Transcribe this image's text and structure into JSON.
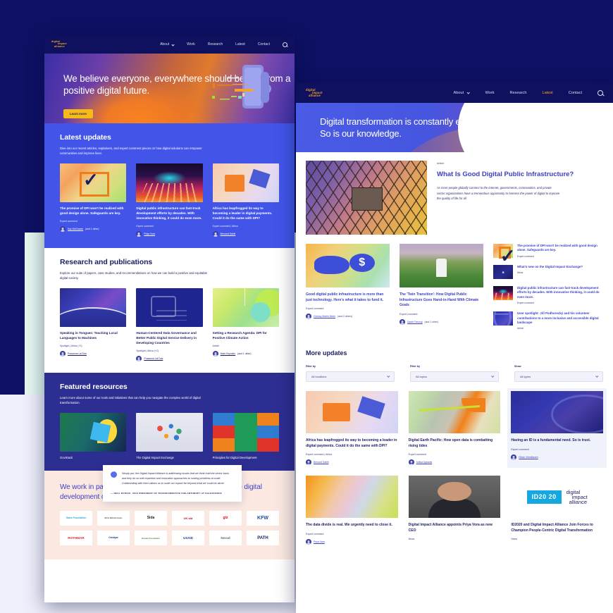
{
  "nav": {
    "logo_lines": [
      "digital",
      "impact",
      "alliance"
    ],
    "links": [
      "About",
      "Work",
      "Research",
      "Latest",
      "Contact"
    ],
    "active_link": "Latest",
    "search_icon": "search-icon",
    "chevron_icon": "chevron-down-icon"
  },
  "home": {
    "hero": {
      "headline": "We believe everyone, everywhere should benefit from a positive digital future.",
      "cta": "Learn more"
    },
    "latest": {
      "title": "Latest updates",
      "lede": "Dive into our recent articles, explainers, and expert comment pieces on how digital solutions can empower communities and improve lives.",
      "cards": [
        {
          "art": "art-check",
          "title": "The promise of DPI won't be realized with good design alone. Safeguards are key.",
          "meta": "Expert comment",
          "author": "Kay McGowan",
          "author_extra": "(and 1 other)"
        },
        {
          "art": "art-road",
          "title": "Digital public infrastructure can fast-track development efforts by decades. With innovative thinking, it could do even more.",
          "meta": "Expert comment",
          "author": "Priya Vora",
          "author_extra": ""
        },
        {
          "art": "art-africa",
          "title": "Africa has leapfrogged its way to becoming a leader in digital payments. Could it do the same with DPI?",
          "meta": "Expert comment | Africa",
          "author": "Bernard Sabiti",
          "author_extra": ""
        }
      ]
    },
    "research": {
      "title": "Research and publications",
      "lede": "Explore our suite of papers, case studies, and recommendations on how we can build a positive and equitable digital society.",
      "cards": [
        {
          "art": "art-wave",
          "title": "Speaking in Tongues: Teaching Local Languages to Machines",
          "meta": "Spotlight | Africa (+2)",
          "author": "Prasanna Lal Das",
          "author_extra": ""
        },
        {
          "art": "art-code",
          "title": "Human-Centered Data Governance and Better Public Digital Service Delivery in Developing Countries",
          "meta": "Spotlight | Africa (+2)",
          "author": "Prasanna Lal Das",
          "author_extra": ""
        },
        {
          "art": "art-green",
          "title": "Setting a Research Agenda: DPI for Positive Climate Action",
          "meta": "Article",
          "author": "Mark Esposito",
          "author_extra": "(and 1 other)"
        }
      ]
    },
    "featured": {
      "title": "Featured resources",
      "lede": "Learn more about some of our tools and initiatives that can help you navigate the complex world of digital transformation.",
      "cards": [
        {
          "art": "art-govstack",
          "title": "GovStack"
        },
        {
          "art": "art-iso",
          "title": "The Digital Impact Exchange"
        },
        {
          "art": "art-grid9",
          "title": "Principles for Digital Development"
        }
      ]
    },
    "quote": {
      "icon": "quote-icon",
      "text": "Simply put, the Digital Impact Alliance is addressing issues that we think hold the sector back, and they do so with expertise and innovative approaches to solving problems at scale. Collaborating with them allows us to scale our impact far beyond what we could do alone.",
      "attribution": "— NEAL MYRICK, VICE PRESIDENT OF TRANSFORMATIVE PHILANTHROPY AT SALESFORCE"
    },
    "partners": {
      "title": "We work in partnership with some of the world's most active digital development champions.",
      "logos": [
        "Gates Foundation",
        "Bill & Melinda Gates",
        "Sida",
        "UK aid",
        "giz",
        "KFW",
        "ROTHMAR",
        "Omidyar",
        "Hewlett Foundation",
        "USAID",
        "Norad",
        "PATH"
      ]
    }
  },
  "latest_page": {
    "hero": {
      "line1": "Digital transformation is constantly evolving.",
      "line2": "So is our knowledge."
    },
    "feature": {
      "art": "art-tower",
      "kicker": "Article",
      "title": "What Is Good Digital Public Infrastructure?",
      "excerpt": "As more people globally connect to the internet, governments, communities, and private sector organizations have a tremendous opportunity to harness the power of digital to improve the quality of life for all"
    },
    "mid_cards": [
      {
        "art": "art-hand",
        "title": "Good digital public infrastructure is more than just technology. Here's what it takes to fund it.",
        "meta": "Expert comment",
        "author": "Chrissy Martin Meier",
        "author_extra": "(and 2 others)"
      },
      {
        "art": "art-farm",
        "title": "The 'Twin Transition': How Digital Public Infrastructure Goes Hand-in-Hand With Climate Goals",
        "meta": "Expert comment",
        "author": "Sarah Farooqi",
        "author_extra": "(and 1 other)"
      }
    ],
    "side_list": [
      {
        "art": "art-check",
        "title": "The promise of DPI won't be realized with good design alone. Safeguards are key.",
        "meta": "Expert comment"
      },
      {
        "art": "art-whatsnew",
        "title": "What's new on the Digital Impact Exchange?",
        "meta": "News"
      },
      {
        "art": "art-road",
        "title": "Digital public infrastructure can fast-track development efforts by decades. With innovative thinking, it could do even more.",
        "meta": "Expert comment"
      },
      {
        "art": "art-dpi2",
        "title": "User spotlight: Jiří Podhorecký and his volunteer contributions to a more inclusive and accessible digital landscape",
        "meta": "Article"
      }
    ],
    "more": {
      "title": "More updates",
      "filters": [
        {
          "label": "Filter by",
          "value": "All locations"
        },
        {
          "label": "Filter by",
          "value": "All topics"
        },
        {
          "label": "Show",
          "value": "All types"
        }
      ],
      "cards": [
        {
          "art": "art-africa",
          "title": "Africa has leapfrogged its way to becoming a leader in digital payments. Could it do the same with DPI?",
          "meta": "Expert comment | Africa",
          "author": "Bernard Sabiti",
          "author_extra": "",
          "highlight": false
        },
        {
          "art": "art-pacific",
          "title": "Digital Earth Pacific: How open data is combatting rising tides",
          "meta": "Expert comment",
          "author": "Aditya Agrawal",
          "author_extra": "",
          "highlight": false
        },
        {
          "art": "art-id",
          "title": "Having an ID is a fundamental need. So is trust.",
          "meta": "Expert comment",
          "author": "Ethan Veneklasen",
          "author_extra": "",
          "highlight": true
        },
        {
          "art": "art-warm",
          "title": "The data divide is real. We urgently need to close it.",
          "meta": "Expert comment",
          "author": "Priya Vora",
          "author_extra": "",
          "highlight": false
        },
        {
          "art": "art-ceo",
          "title": "Digital Impact Alliance appoints Priya Vora as new CEO",
          "meta": "News",
          "author": "",
          "author_extra": "",
          "highlight": false
        },
        {
          "art": "id2020",
          "title": "ID2020 and Digital Impact Alliance Join Forces to Champion People-Centric Digital Transformation",
          "meta": "News",
          "author": "",
          "author_extra": "",
          "highlight": false,
          "id2020_label": "ID20 20"
        }
      ]
    }
  },
  "colors": {
    "navy": "#0E1164",
    "brand_blue": "#4255E8",
    "accent_orange": "#F5A623",
    "mint": "#E3F7EF",
    "peach": "#FBE9E1",
    "lavender": "#EEEFFB"
  }
}
